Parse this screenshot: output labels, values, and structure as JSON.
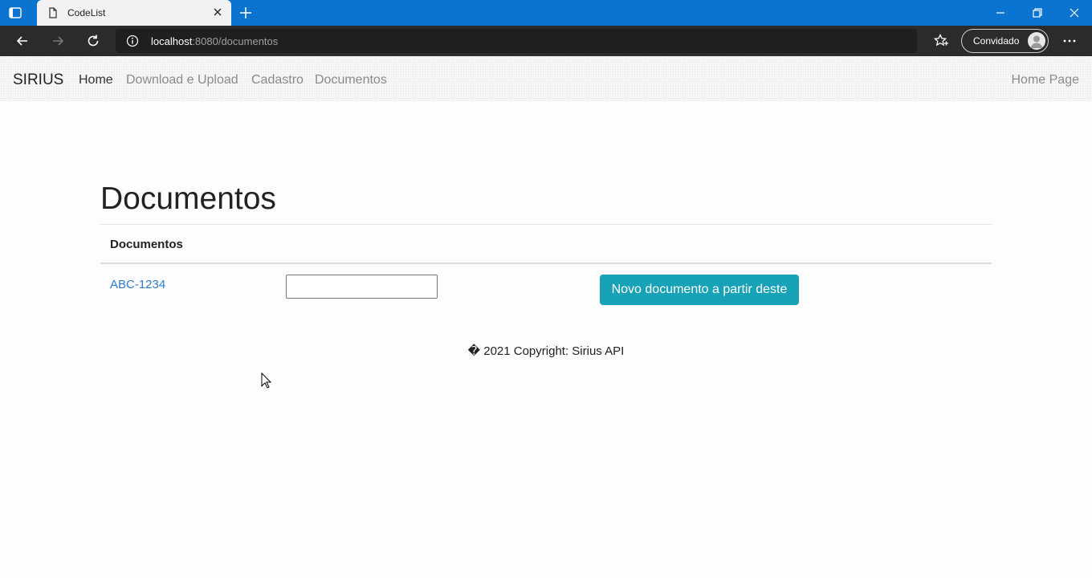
{
  "browser": {
    "tab_title": "CodeList",
    "url_host": "localhost",
    "url_rest": ":8080/documentos",
    "profile_label": "Convidado",
    "icons": [
      "tab-actions-icon",
      "page-icon",
      "close-icon",
      "plus-icon",
      "minimize-icon",
      "restore-icon",
      "close-window-icon",
      "back-icon",
      "forward-icon",
      "refresh-icon",
      "info-icon",
      "favorites-icon",
      "avatar-icon",
      "more-icon"
    ]
  },
  "navbar": {
    "brand": "SIRIUS",
    "links": [
      "Home",
      "Download e Upload",
      "Cadastro",
      "Documentos"
    ],
    "right_link": "Home Page"
  },
  "page": {
    "title": "Documentos",
    "table_header": "Documentos",
    "rows": [
      {
        "code": "ABC-1234",
        "input_value": "",
        "button_label": "Novo documento a partir deste"
      }
    ],
    "footer": "� 2021 Copyright: Sirius API"
  },
  "colors": {
    "tabstrip": "#0b73d0",
    "toolbar": "#2b2b2b",
    "link": "#2a7bd1",
    "button": "#17a2b8"
  }
}
